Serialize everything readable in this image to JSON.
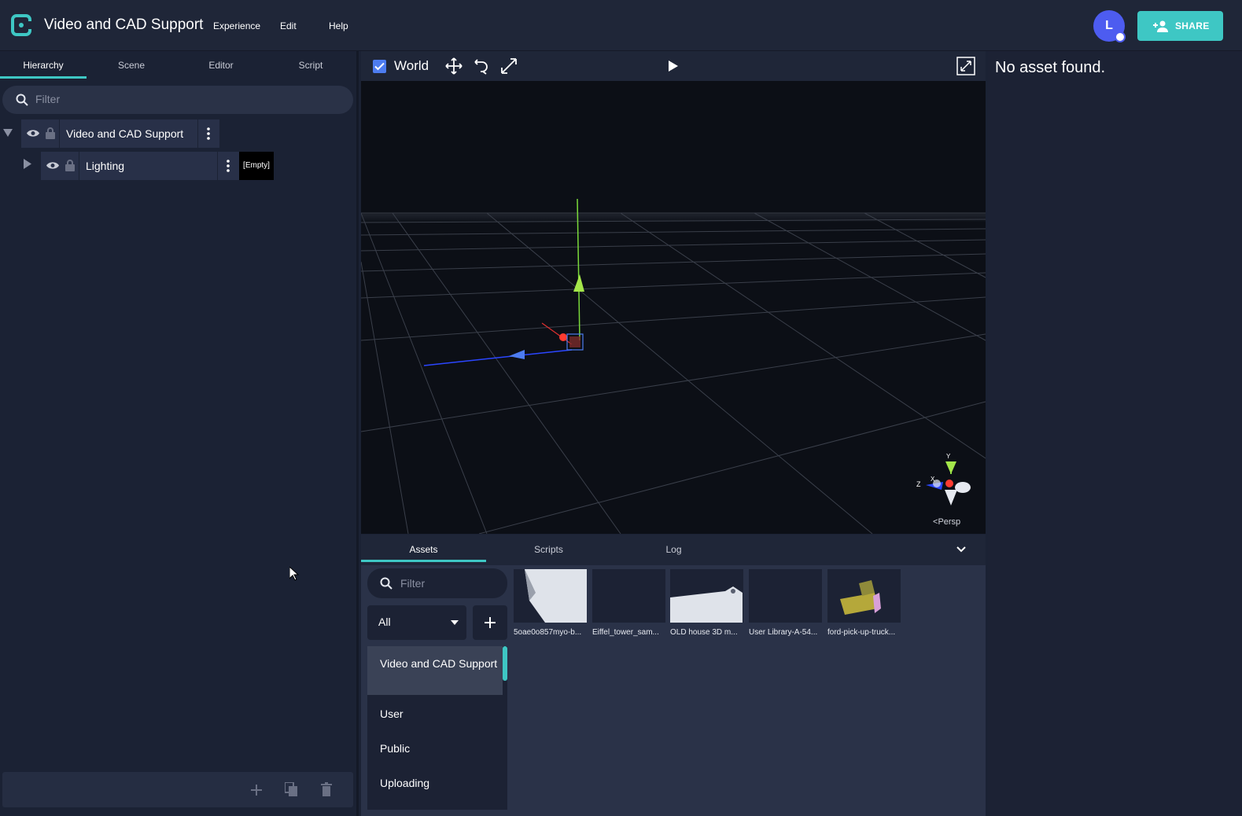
{
  "app": {
    "title": "Video and CAD Support"
  },
  "menu": [
    "Experience",
    "Edit",
    "Help"
  ],
  "user": {
    "initial": "L"
  },
  "share": {
    "label": "SHARE"
  },
  "colors": {
    "accent": "#3ec7c4",
    "avatar": "#4d5cf0",
    "panel": "#1b2234",
    "viewport": "#0c0f16"
  },
  "left_panel": {
    "tabs": [
      "Hierarchy",
      "Scene",
      "Editor",
      "Script"
    ],
    "active_tab": "Hierarchy",
    "filter_placeholder": "Filter",
    "tree": [
      {
        "label": "Video and CAD Support",
        "expanded": true,
        "visible": true,
        "locked": true
      },
      {
        "label": "Lighting",
        "expanded": false,
        "visible": true,
        "locked": true,
        "tag": "[Empty]"
      }
    ],
    "bottom_actions": [
      "add-icon",
      "duplicate-icon",
      "delete-icon"
    ]
  },
  "viewport": {
    "world_label": "World",
    "world_checked": true,
    "tools": [
      "move-icon",
      "rotate-icon",
      "scale-icon",
      "play-icon",
      "fullscreen-icon"
    ],
    "gizmo_axes": {
      "y": "Y",
      "z": "Z",
      "x": "X"
    },
    "camera_mode": "Persp"
  },
  "assets_panel": {
    "tabs": [
      "Assets",
      "Scripts",
      "Log"
    ],
    "active_tab": "Assets",
    "filter_placeholder": "Filter",
    "dropdown_value": "All",
    "libraries": [
      "Video and CAD Support",
      "User",
      "Public",
      "Uploading"
    ],
    "active_library": "Video and CAD Support",
    "items": [
      {
        "label": "5oae0o857myo-b..."
      },
      {
        "label": "Eiffel_tower_sam..."
      },
      {
        "label": "OLD house 3D m..."
      },
      {
        "label": "User Library-A-54..."
      },
      {
        "label": "ford-pick-up-truck..."
      }
    ]
  },
  "right_panel": {
    "message": "No asset found."
  }
}
